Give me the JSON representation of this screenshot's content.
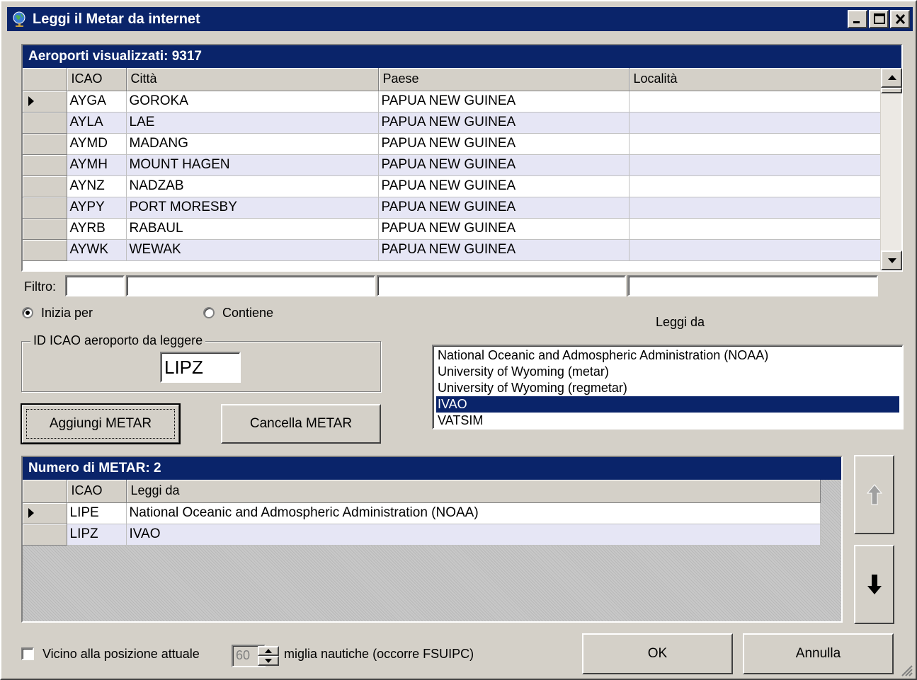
{
  "window": {
    "title": "Leggi il Metar da internet"
  },
  "airports": {
    "header": "Aeroporti visualizzati: 9317",
    "columns": [
      "ICAO",
      "Città",
      "Paese",
      "Località"
    ],
    "rows": [
      {
        "icao": "AYGA",
        "city": "GOROKA",
        "country": "PAPUA NEW GUINEA",
        "locality": ""
      },
      {
        "icao": "AYLA",
        "city": "LAE",
        "country": "PAPUA NEW GUINEA",
        "locality": ""
      },
      {
        "icao": "AYMD",
        "city": "MADANG",
        "country": "PAPUA NEW GUINEA",
        "locality": ""
      },
      {
        "icao": "AYMH",
        "city": "MOUNT HAGEN",
        "country": "PAPUA NEW GUINEA",
        "locality": ""
      },
      {
        "icao": "AYNZ",
        "city": "NADZAB",
        "country": "PAPUA NEW GUINEA",
        "locality": ""
      },
      {
        "icao": "AYPY",
        "city": "PORT MORESBY",
        "country": "PAPUA NEW GUINEA",
        "locality": ""
      },
      {
        "icao": "AYRB",
        "city": "RABAUL",
        "country": "PAPUA NEW GUINEA",
        "locality": ""
      },
      {
        "icao": "AYWK",
        "city": "WEWAK",
        "country": "PAPUA NEW GUINEA",
        "locality": ""
      }
    ]
  },
  "filter": {
    "label": "Filtro:",
    "values": [
      "",
      "",
      "",
      ""
    ]
  },
  "match_mode": {
    "starts_with": "Inizia per",
    "contains": "Contiene",
    "selected": "starts_with"
  },
  "icao_input": {
    "legend": "ID ICAO aeroporto da leggere",
    "value": "LIPZ"
  },
  "buttons": {
    "add": "Aggiungi METAR",
    "delete": "Cancella METAR",
    "ok": "OK",
    "cancel": "Annulla"
  },
  "source": {
    "label": "Leggi da",
    "options": [
      "National Oceanic and Admospheric Administration (NOAA)",
      "University of Wyoming (metar)",
      "University of Wyoming (regmetar)",
      "IVAO",
      "VATSIM"
    ],
    "selected": "IVAO"
  },
  "metars": {
    "header": "Numero di METAR: 2",
    "columns": [
      "ICAO",
      "Leggi da"
    ],
    "rows": [
      {
        "icao": "LIPE",
        "source": "National Oceanic and Admospheric Administration (NOAA)"
      },
      {
        "icao": "LIPZ",
        "source": "IVAO"
      }
    ]
  },
  "nearby": {
    "label": "Vicino alla posizione attuale",
    "miles": "60",
    "unit_label": "miglia nautiche (occorre FSUIPC)",
    "checked": false
  }
}
